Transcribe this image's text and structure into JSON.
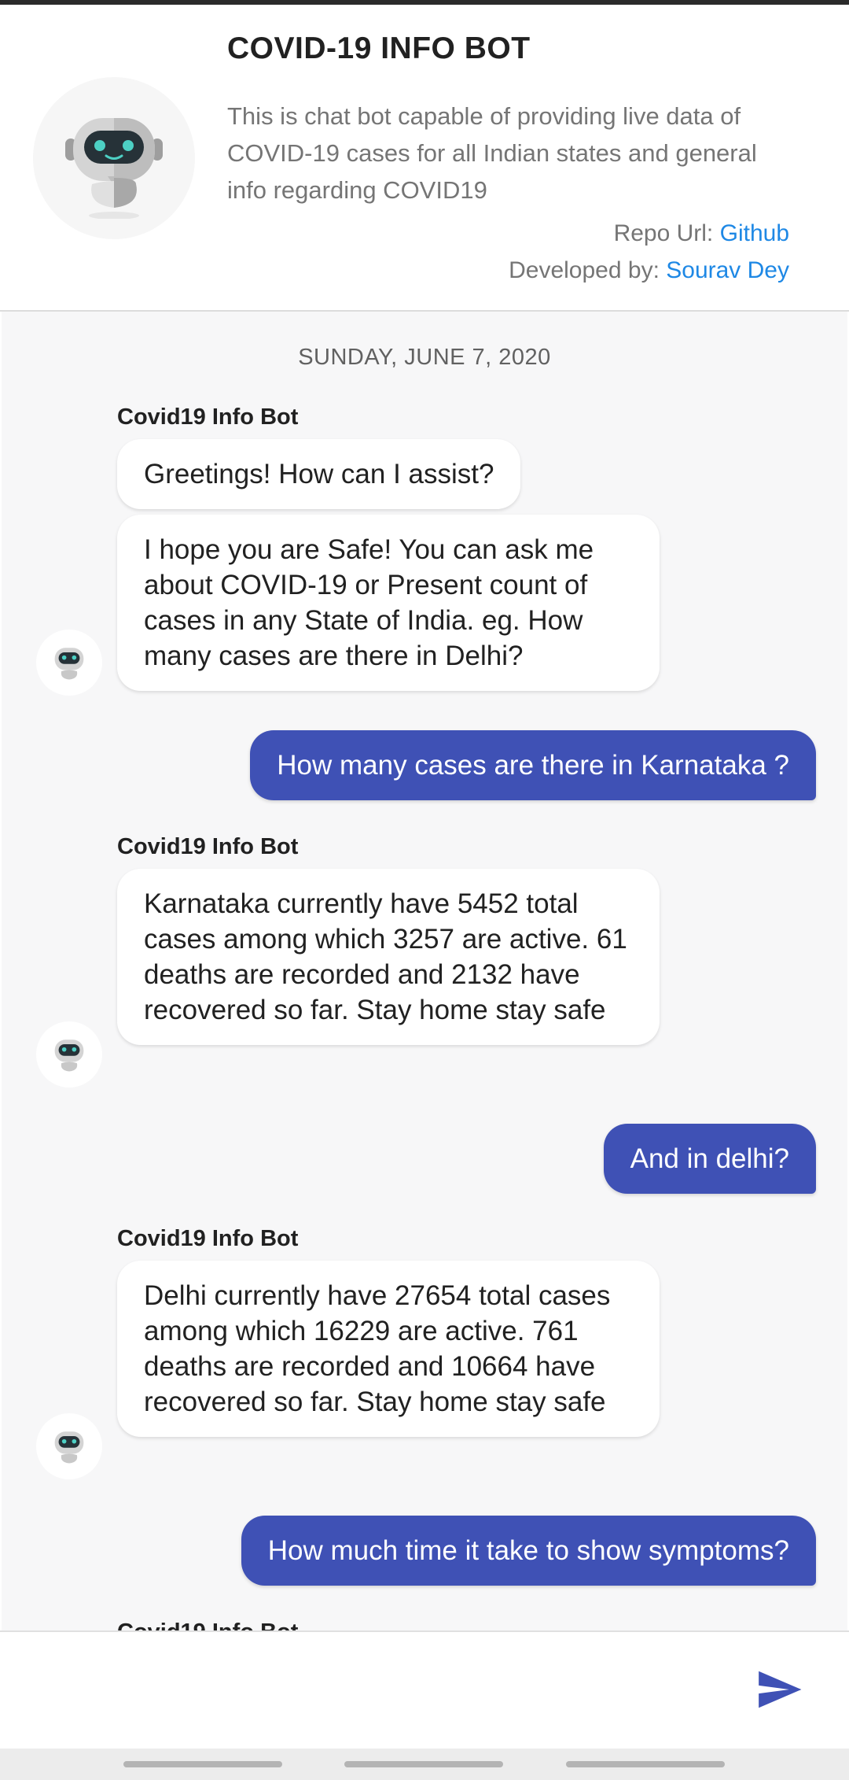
{
  "header": {
    "title": "COVID-19 INFO BOT",
    "description": "This is chat bot capable of providing live data of COVID-19 cases for all Indian states and general info regarding COVID19",
    "repo_label": "Repo Url: ",
    "repo_link": "Github",
    "dev_label": "Developed by: ",
    "dev_link": "Sourav Dey"
  },
  "chat": {
    "date": "SUNDAY, JUNE 7, 2020",
    "bot_name": "Covid19 Info Bot",
    "messages": [
      {
        "from": "bot",
        "text": "Greetings! How can I assist?"
      },
      {
        "from": "bot",
        "text": "I hope you are Safe! You can ask me about COVID-19 or Present count of cases in any State of India. eg. How many cases are there in Delhi?"
      },
      {
        "from": "user",
        "text": "How many cases are there in Karnataka ?"
      },
      {
        "from": "bot",
        "text": "Karnataka currently have 5452 total cases among which 3257 are active. 61 deaths are recorded and 2132 have recovered so far. Stay home stay safe"
      },
      {
        "from": "user",
        "text": "And in delhi?"
      },
      {
        "from": "bot",
        "text": "Delhi currently have 27654 total cases among which 16229 are active. 761 deaths are recorded and 10664 have recovered so far. Stay home stay safe"
      },
      {
        "from": "user",
        "text": "How much time it take to show symptoms?"
      }
    ]
  },
  "composer": {
    "placeholder": "",
    "send_icon": "send-icon"
  },
  "colors": {
    "accent": "#3f51b5",
    "link": "#1e88e5",
    "chat_bg": "#f7f7f8"
  }
}
